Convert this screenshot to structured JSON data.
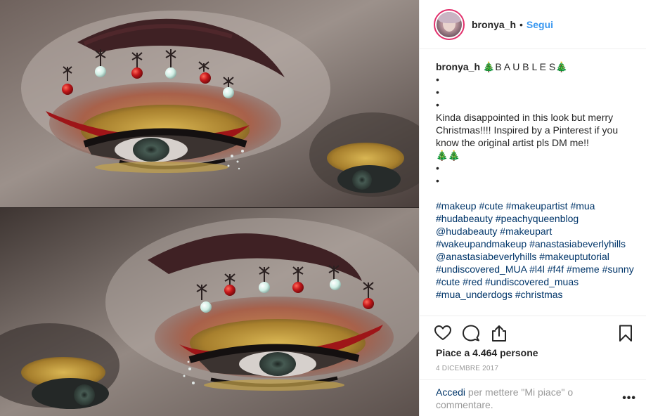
{
  "post": {
    "username": "bronya_h",
    "dot": "•",
    "follow_label": "Segui",
    "caption": {
      "username": "bronya_h",
      "title": "🎄B A U B L E S🎄",
      "bullet": "•",
      "text": "Kinda disappointed in this look but merry Christmas!!!! Inspired by a Pinterest if you know the original artist pls DM me!!",
      "trees": "🎄🎄",
      "hashtags": "#makeup #cute #makeupartist #mua #hudabeauty #peachyqueenblog @hudabeauty #makeupart #wakeupandmakeup #anastasiabeverlyhills @anastasiabeverlyhills #makeuptutorial #undiscovered_MUA #l4l #f4f #meme #sunny #cute #red #undiscovered_muas #mua_underdogs #christmas"
    },
    "likes": "Piace a 4.464 persone",
    "date": "4 DICEMBRE 2017",
    "login_link": "Accedi",
    "login_text": " per mettere \"Mi piace\" o commentare.",
    "more_label": "•••"
  },
  "icons": {
    "like": "heart-icon",
    "comment": "comment-icon",
    "share": "share-icon",
    "save": "bookmark-icon"
  },
  "colors": {
    "link_blue": "#3897f0",
    "hashtag_blue": "#003569",
    "muted_text": "#999999",
    "text": "#262626",
    "story_ring": "#e1306c"
  }
}
